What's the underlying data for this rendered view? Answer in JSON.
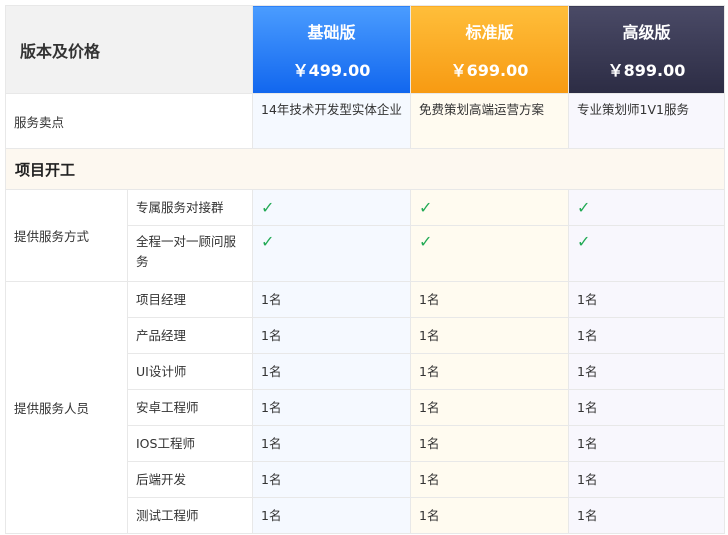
{
  "header": {
    "title": "版本及价格",
    "plans": [
      {
        "name": "基础版",
        "price": "￥499.00"
      },
      {
        "name": "标准版",
        "price": "￥699.00"
      },
      {
        "name": "高级版",
        "price": "￥899.00"
      }
    ]
  },
  "selling": {
    "label": "服务卖点",
    "values": [
      "14年技术开发型实体企业",
      "免费策划高端运营方案",
      "专业策划师1V1服务"
    ]
  },
  "section": {
    "title": "项目开工"
  },
  "service_mode": {
    "label": "提供服务方式",
    "items": [
      {
        "name": "专属服务对接群",
        "values": [
          "✓",
          "✓",
          "✓"
        ]
      },
      {
        "name": "全程一对一顾问服务",
        "values": [
          "✓",
          "✓",
          "✓"
        ]
      }
    ]
  },
  "staff": {
    "label": "提供服务人员",
    "items": [
      {
        "name": "项目经理",
        "values": [
          "1名",
          "1名",
          "1名"
        ]
      },
      {
        "name": "产品经理",
        "values": [
          "1名",
          "1名",
          "1名"
        ]
      },
      {
        "name": "UI设计师",
        "values": [
          "1名",
          "1名",
          "1名"
        ]
      },
      {
        "name": "安卓工程师",
        "values": [
          "1名",
          "1名",
          "1名"
        ]
      },
      {
        "name": "IOS工程师",
        "values": [
          "1名",
          "1名",
          "1名"
        ]
      },
      {
        "name": "后端开发",
        "values": [
          "1名",
          "1名",
          "1名"
        ]
      },
      {
        "name": "测试工程师",
        "values": [
          "1名",
          "1名",
          "1名"
        ]
      }
    ]
  },
  "colors": {
    "basic": "#1a74f2",
    "standard": "#f8a31a",
    "premium": "#34344e",
    "check": "#22aa55"
  }
}
